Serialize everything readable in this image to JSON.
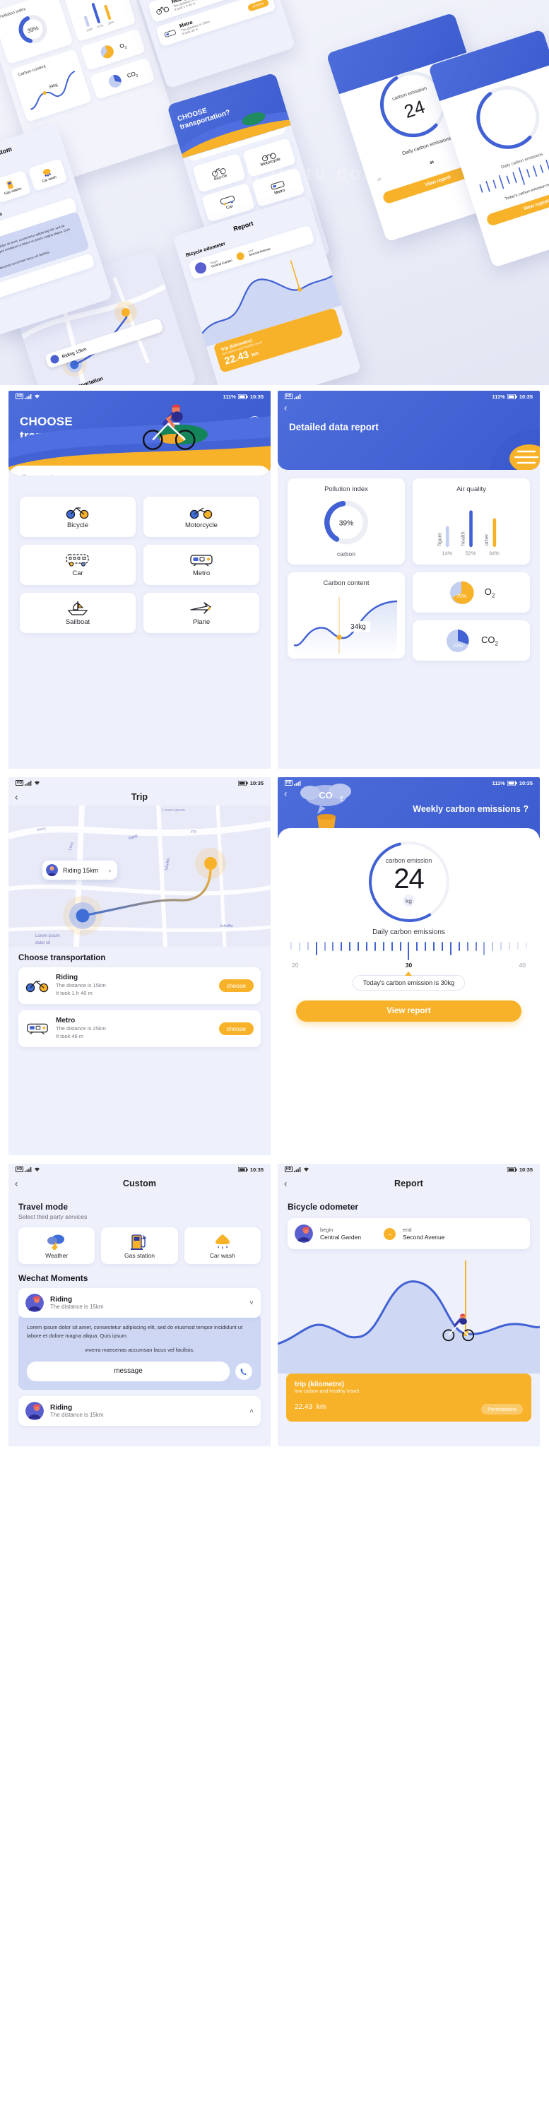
{
  "brand": {
    "blue": "#4161d4",
    "yellow": "#f8b229",
    "bg": "#eef0fb",
    "light_blue": "#cdd6f3"
  },
  "status_bar": {
    "battery_percent": "111%",
    "time": "10:35",
    "time_alt": "10:35"
  },
  "screens": {
    "choose": {
      "title_line1": "CHOOSE",
      "title_line2": "transportation?",
      "search_placeholder": "search",
      "tiles": [
        {
          "label": "Bicycle",
          "icon": "bicycle-icon"
        },
        {
          "label": "Motorcycle",
          "icon": "motorcycle-icon"
        },
        {
          "label": "Car",
          "icon": "bus-icon"
        },
        {
          "label": "Metro",
          "icon": "metro-icon"
        },
        {
          "label": "Sailboat",
          "icon": "sailboat-icon"
        },
        {
          "label": "Plane",
          "icon": "plane-icon"
        }
      ]
    },
    "report_detail": {
      "title": "Detailed data report",
      "pollution": {
        "label": "Pollution index",
        "value": "39%",
        "sub": "carbon"
      },
      "air": {
        "label": "Air quality"
      },
      "carbon": {
        "label": "Carbon content",
        "value": "34kg"
      },
      "o2": {
        "label": "O",
        "sub": "2",
        "value": "75%"
      },
      "co2": {
        "label": "CO",
        "sub": "2",
        "value": "22%"
      }
    },
    "trip": {
      "nav_title": "Trip",
      "bubble_text": "Riding 15km",
      "map_labels": [
        "mwry",
        "Lorem ipsum",
        "aqaq",
        "Lore",
        "yyy",
        "fahvffm",
        "fahvffm",
        "Lorem ipsum",
        "dolor sit"
      ],
      "section_title": "Choose transportation",
      "options": [
        {
          "name": "Riding",
          "line1": "The distance is 15km",
          "line2": "It took 1 h 40 m",
          "action": "choose",
          "icon": "bicycle-icon"
        },
        {
          "name": "Metro",
          "line1": "The distance is 25km",
          "line2": "It took 46 m",
          "action": "choose",
          "icon": "metro-icon"
        }
      ]
    },
    "weekly": {
      "title": "Weekly carbon emissions ?",
      "cloud_label": "CO",
      "cloud_sub": "2",
      "ring_label": "carbon emission",
      "ring_value": "24",
      "ring_unit": "kg",
      "daily_label": "Daily carbon emissions",
      "scale_min": "20",
      "scale_mid": "30",
      "scale_max": "40",
      "tooltip": "Today's carbon emission is 30kg",
      "view_report": "View report"
    },
    "custom": {
      "nav_title": "Custom",
      "travel_mode_title": "Travel mode",
      "travel_mode_sub": "Select third party services",
      "services": [
        {
          "label": "Weather",
          "icon": "weather-icon"
        },
        {
          "label": "Gas station",
          "icon": "gas-station-icon"
        },
        {
          "label": "Car wash",
          "icon": "car-wash-icon"
        }
      ],
      "moments_title": "Wechat Moments",
      "moment1": {
        "name": "Riding",
        "sub": "The distance is 15km",
        "chevron": "chevron-down-icon",
        "body1": "Lorem ipsum dolor sit amet, consectetur adipiscing elit, sed do eiusmod tempor incididunt ut labore et dolore magna aliqua. Quis ipsum",
        "body2": "viverra maecenas accumsan lacus vel facilisis.",
        "message_label": "message"
      },
      "moment2": {
        "name": "Riding",
        "sub": "The distance is 15km",
        "chevron": "chevron-up-icon"
      }
    },
    "report": {
      "nav_title": "Report",
      "section_title": "Bicycle odometer",
      "begin_key": "begin",
      "begin_value": "Central Garden",
      "end_key": "end",
      "end_value": "Second Avenue",
      "trip_title": "trip (kilometre)",
      "trip_sub": "low carbon and healthy travel",
      "trip_value": "22.43",
      "trip_unit": "km",
      "permissions": "Permissions"
    }
  },
  "chart_data": [
    {
      "type": "pie",
      "title": "Pollution index",
      "labels": [
        "carbon",
        "other"
      ],
      "values": [
        39,
        61
      ],
      "value_label": "39%",
      "colors": [
        "#4161d4",
        "#e9eaf2"
      ]
    },
    {
      "type": "bar",
      "title": "Air quality",
      "categories": [
        "figure",
        "health",
        "other"
      ],
      "values": [
        14,
        52,
        34
      ],
      "tick_labels": [
        "14%",
        "52%",
        "34%"
      ],
      "colors": [
        "#c3cff0",
        "#4161d4",
        "#f8b229"
      ],
      "ylim": [
        0,
        60
      ]
    },
    {
      "type": "line",
      "title": "Carbon content",
      "annotation": "34kg",
      "x": [
        0,
        1,
        2,
        3,
        4,
        5,
        6
      ],
      "y": [
        18,
        10,
        38,
        52,
        30,
        22,
        74
      ],
      "color": "#4161d4"
    },
    {
      "type": "pie",
      "title": "O2",
      "labels": [
        "O2",
        "rest"
      ],
      "values": [
        75,
        25
      ],
      "value_label": "75%",
      "colors": [
        "#f8b229",
        "#c3cff0"
      ]
    },
    {
      "type": "pie",
      "title": "CO2",
      "labels": [
        "CO2",
        "rest"
      ],
      "values": [
        22,
        78
      ],
      "value_label": "22%",
      "colors": [
        "#4161d4",
        "#c3cff0"
      ]
    },
    {
      "type": "line",
      "title": "Daily carbon emissions",
      "xlabel": "",
      "ylabel": "",
      "x": [
        20,
        30,
        40
      ],
      "tick_count": 29,
      "marker_value": 30,
      "annotation": "Today's carbon emission is 30kg",
      "ylim": [
        20,
        45
      ]
    },
    {
      "type": "area",
      "title": "Bicycle odometer",
      "x": [
        0,
        1,
        2,
        3,
        4,
        5,
        6,
        7,
        8
      ],
      "y": [
        8,
        22,
        14,
        18,
        62,
        40,
        26,
        34,
        30
      ],
      "marker_x": 6,
      "color": "#4161d4",
      "fill": "#c3cff0"
    },
    {
      "type": "gauge",
      "title": "carbon emission",
      "value": 24,
      "unit": "kg",
      "ylim": [
        0,
        40
      ],
      "color": "#4161d4"
    }
  ]
}
